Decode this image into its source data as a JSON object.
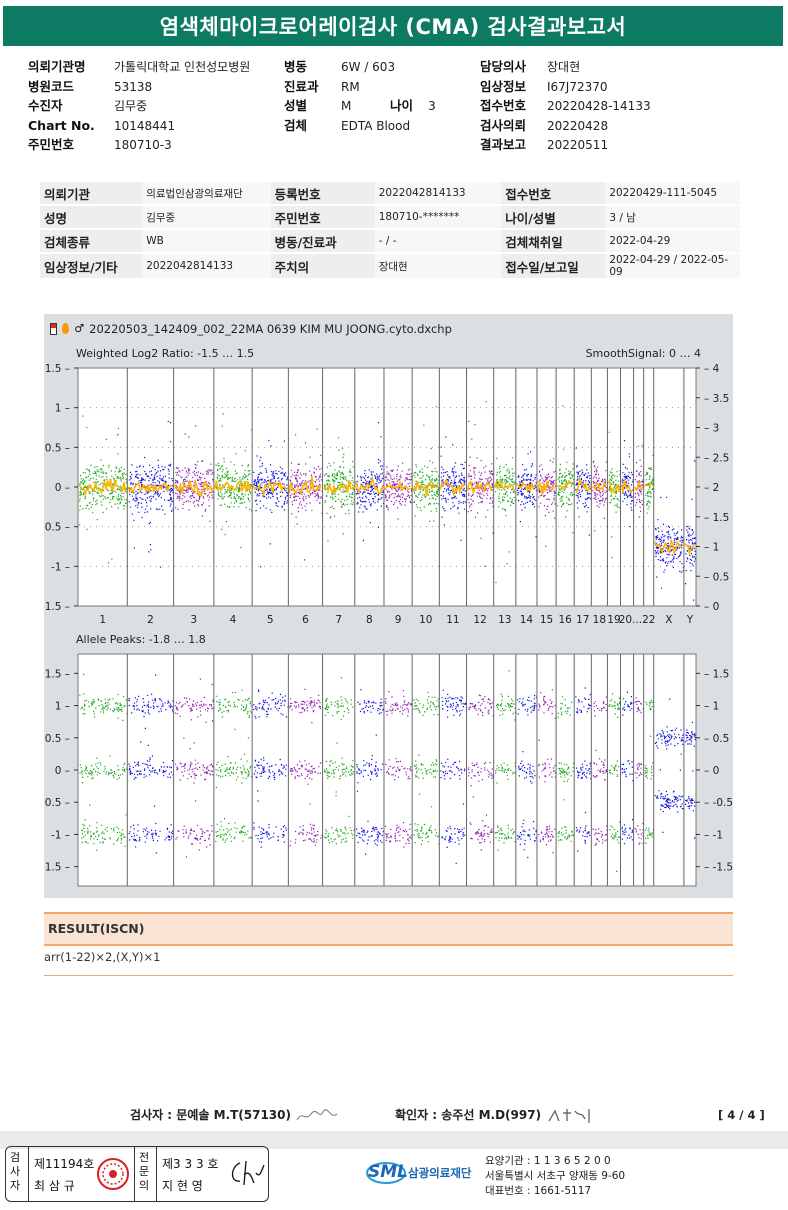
{
  "title": "염색체마이크로어레이검사 (CMA) 검사결과보고서",
  "header_left": [
    {
      "label": "의뢰기관명",
      "value": "가톨릭대학교 인천성모병원"
    },
    {
      "label": "병원코드",
      "value": "53138"
    },
    {
      "label": "수진자",
      "value": "김무중"
    },
    {
      "label": "Chart No.",
      "value": "10148441"
    },
    {
      "label": "주민번호",
      "value": "180710-3"
    }
  ],
  "header_mid": [
    {
      "label": "병동",
      "value": "6W / 603"
    },
    {
      "label": "진료과",
      "value": "RM"
    },
    {
      "label": "성별",
      "value": "M"
    },
    {
      "label": "검체",
      "value": "EDTA Blood"
    }
  ],
  "age": {
    "label": "나이",
    "value": "3"
  },
  "header_right": [
    {
      "label": "담당의사",
      "value": "장대현"
    },
    {
      "label": "임상정보",
      "value": "I67J72370"
    },
    {
      "label": "접수번호",
      "value": "20220428-14133"
    },
    {
      "label": "검사의뢰",
      "value": "20220428"
    },
    {
      "label": "결과보고",
      "value": "20220511"
    }
  ],
  "patient_table": [
    [
      {
        "label": "의뢰기관",
        "value": "의료법인삼광의료재단"
      },
      {
        "label": "등록번호",
        "value": "2022042814133"
      },
      {
        "label": "접수번호",
        "value": "20220429-111-5045"
      }
    ],
    [
      {
        "label": "성명",
        "value": "김무중"
      },
      {
        "label": "주민번호",
        "value": "180710-*******"
      },
      {
        "label": "나이/성별",
        "value": "3 / 남"
      }
    ],
    [
      {
        "label": "검체종류",
        "value": "WB"
      },
      {
        "label": "병동/진료과",
        "value": "- / -"
      },
      {
        "label": "검체채취일",
        "value": "2022-04-29"
      }
    ],
    [
      {
        "label": "임상정보/기타",
        "value": "2022042814133"
      },
      {
        "label": "주치의",
        "value": "장대현"
      },
      {
        "label": "접수일/보고일",
        "value": "2022-04-29 / 2022-05-09"
      }
    ]
  ],
  "chart_file": "20220503_142409_002_22MA 0639 KIM MU JOONG.cyto.dxchp",
  "chart_data": [
    {
      "type": "scatter",
      "title": "Weighted Log2 Ratio: -1.5 … 1.5",
      "right_title": "SmoothSignal: 0 … 4",
      "ylim": [
        -1.5,
        1.5
      ],
      "y_ticks": [
        "1.5",
        "1",
        "0.5",
        "0",
        "-0.5",
        "-1",
        "-1.5"
      ],
      "y2lim": [
        0,
        4
      ],
      "y2_ticks": [
        "4",
        "3.5",
        "3",
        "2.5",
        "2",
        "1.5",
        "1",
        "0.5",
        "0"
      ],
      "categories": [
        "1",
        "2",
        "3",
        "4",
        "5",
        "6",
        "7",
        "8",
        "9",
        "10",
        "11",
        "12",
        "13",
        "14",
        "15",
        "16",
        "17",
        "18",
        "19",
        "20",
        "21",
        "22",
        "X",
        "Y"
      ],
      "x_labels": [
        "1",
        "2",
        "3",
        "4",
        "5",
        "6",
        "7",
        "8",
        "9",
        "10",
        "11",
        "12",
        "13",
        "14",
        "15",
        "16",
        "17",
        "18",
        "19",
        "20...22",
        "X",
        "Y"
      ],
      "smooth_signal": [
        2,
        2,
        2,
        2,
        2,
        2,
        2,
        2,
        2,
        2,
        2,
        2,
        2,
        2,
        2,
        2,
        2,
        2,
        2,
        2,
        2,
        2,
        1,
        1
      ],
      "log2_center": [
        0,
        0,
        0,
        0,
        0,
        0,
        0,
        0,
        0,
        0,
        0,
        0,
        0,
        0,
        0,
        0,
        0,
        0,
        0,
        0,
        0,
        0,
        -0.75,
        -0.75
      ]
    },
    {
      "type": "scatter",
      "title": "Allele Peaks: -1.8 … 1.8",
      "ylim": [
        -1.8,
        1.8
      ],
      "y_ticks": [
        "1.5",
        "1",
        "0.5",
        "0",
        "-0.5",
        "-1",
        "-1.5"
      ],
      "y2_ticks": [
        "1.5",
        "1",
        "0.5",
        "0",
        "-0.5",
        "-1",
        "-1.5"
      ],
      "autosome_peaks": [
        1.0,
        0,
        -1.0
      ],
      "x_peaks": [
        0.5,
        -0.5
      ]
    }
  ],
  "colors": {
    "chr_a": "#1aa51a",
    "chr_b": "#1010e0",
    "chr_c": "#8e1fb0",
    "smooth": "#ffb400",
    "title_bar": "#0d7a64"
  },
  "result": {
    "heading": "RESULT(ISCN)",
    "text": "arr(1-22)×2,(X,Y)×1"
  },
  "signatures": {
    "tester": "검사자 : 문예솔 M.T(57130)",
    "confirmer": "확인자 : 송주선 M.D(997)",
    "page": "[ 4 / 4 ]"
  },
  "stamp": {
    "col1": "검사자",
    "col1_no": "제11194호",
    "col1_name": "최 삼 규",
    "col2": "전문의",
    "col2_no": "제3 3 3 호",
    "col2_name": "지 현 영"
  },
  "org": {
    "logo": "SML",
    "name": "삼광의료재단",
    "line1": "요양기관 : 1 1 3 6 5 2 0 0",
    "line2": "서울특별시 서초구 양재동 9-60",
    "line3": "대표번호 : 1661-5117"
  }
}
